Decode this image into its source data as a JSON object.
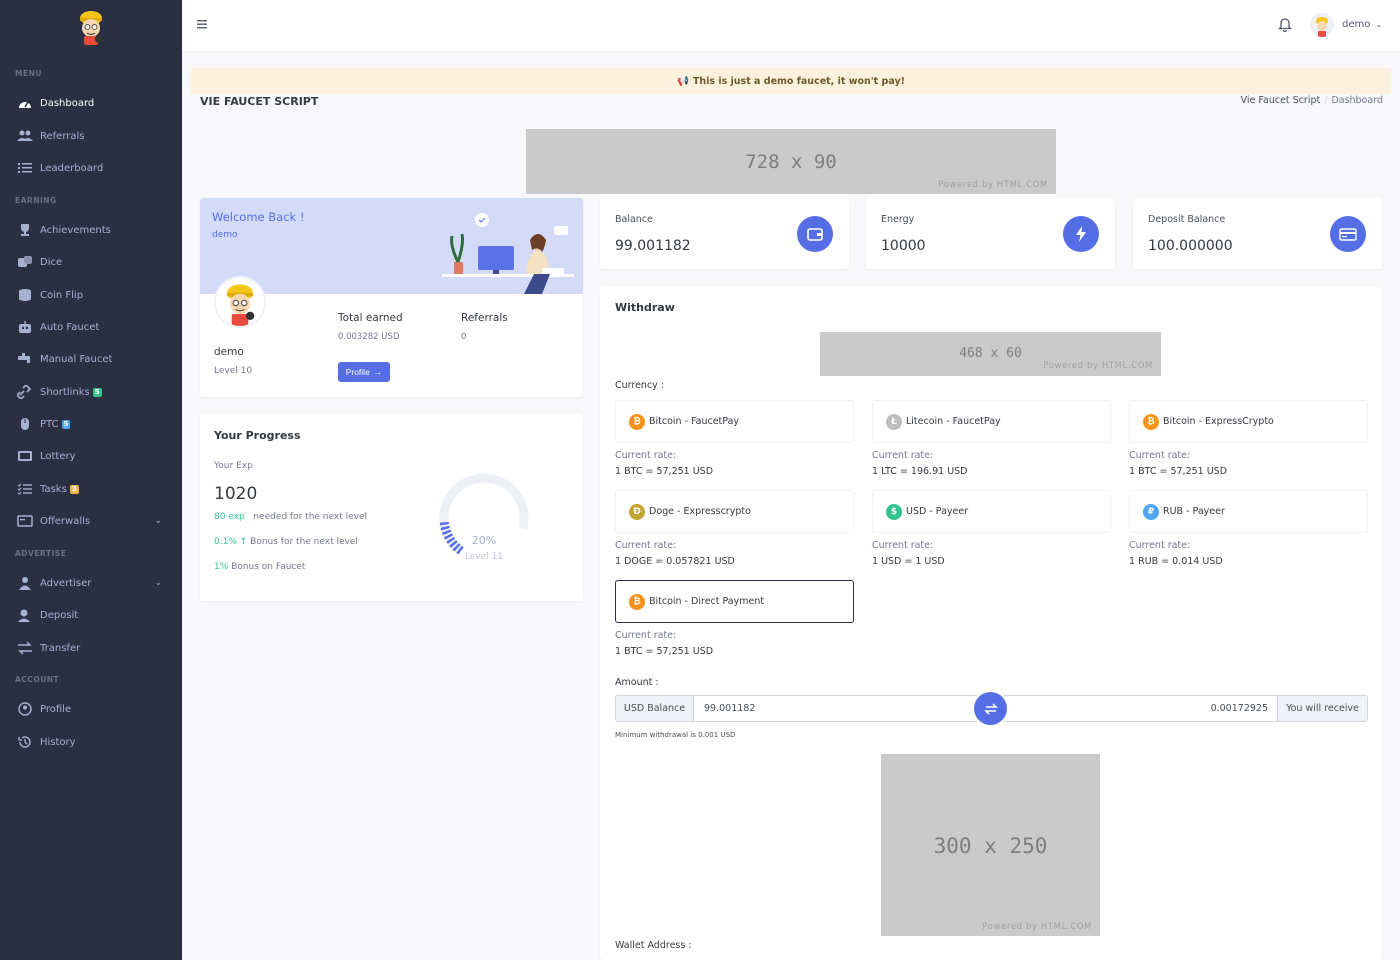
{
  "sidebar": {
    "sections": {
      "menu": "MENU",
      "earning": "EARNING",
      "advertise": "ADVERTISE",
      "account": "ACCOUNT"
    },
    "items": [
      {
        "label": "Dashboard",
        "icon": "dashboard-icon"
      },
      {
        "label": "Referrals",
        "icon": "users-icon"
      },
      {
        "label": "Leaderboard",
        "icon": "list-icon"
      },
      {
        "label": "Achievements",
        "icon": "trophy-icon"
      },
      {
        "label": "Dice",
        "icon": "dice-icon"
      },
      {
        "label": "Coin Flip",
        "icon": "coins-icon"
      },
      {
        "label": "Auto Faucet",
        "icon": "robot-icon"
      },
      {
        "label": "Manual Faucet",
        "icon": "faucet-icon"
      },
      {
        "label": "Shortlinks",
        "icon": "link-icon",
        "badge": "5"
      },
      {
        "label": "PTC",
        "icon": "mouse-icon",
        "badge": "5"
      },
      {
        "label": "Lottery",
        "icon": "ticket-icon"
      },
      {
        "label": "Tasks",
        "icon": "tasks-icon",
        "badge": "3"
      },
      {
        "label": "Offerwalls",
        "icon": "window-icon"
      },
      {
        "label": "Advertiser",
        "icon": "user-tie-icon"
      },
      {
        "label": "Deposit",
        "icon": "deposit-icon"
      },
      {
        "label": "Transfer",
        "icon": "transfer-icon"
      },
      {
        "label": "Profile",
        "icon": "profile-icon"
      },
      {
        "label": "History",
        "icon": "history-icon"
      }
    ]
  },
  "topbar": {
    "user": "demo"
  },
  "alert": "This is just a demo faucet, it won't pay!",
  "page": {
    "title": "VIE FAUCET SCRIPT",
    "breadcrumb": [
      "Vie Faucet Script",
      "Dashboard"
    ]
  },
  "ads": {
    "top": {
      "size": "728 x 90",
      "powered": "Powered by HTML.COM"
    },
    "withdraw": {
      "size": "468 x 60",
      "powered": "Powered by HTML.COM"
    },
    "bottom": {
      "size": "300 x 250",
      "powered": "Powered by HTML.COM"
    }
  },
  "welcome": {
    "title": "Welcome Back !",
    "subtitle": "demo",
    "username": "demo",
    "level": "Level 10",
    "total_earned_label": "Total earned",
    "total_earned": "0.003282 USD",
    "referrals_label": "Referrals",
    "referrals": "0",
    "profile_button": "Profile"
  },
  "progress": {
    "title": "Your Progress",
    "exp_label": "Your Exp",
    "exp": "1020",
    "needed_value": "80 exp",
    "needed_text": "needed for the next level",
    "bonus_next_value": "0.1%",
    "bonus_next_text": "Bonus for the next level",
    "bonus_value": "1%",
    "bonus_text": "Bonus on Faucet",
    "percent": "20%",
    "percent_fraction": 0.2,
    "next_level": "Level 11"
  },
  "stats": [
    {
      "label": "Balance",
      "value": "99.001182",
      "icon": "wallet-icon"
    },
    {
      "label": "Energy",
      "value": "10000",
      "icon": "bolt-icon"
    },
    {
      "label": "Deposit Balance",
      "value": "100.000000",
      "icon": "card-icon"
    }
  ],
  "withdraw": {
    "title": "Withdraw",
    "currency_label": "Currency :",
    "rate_label": "Current rate:",
    "currencies": [
      {
        "name": "Bitcoin - FaucetPay",
        "rate": "1 BTC = 57,251 USD",
        "symbol": "₿",
        "color": "#f7931a"
      },
      {
        "name": "Litecoin - FaucetPay",
        "rate": "1 LTC = 196.91 USD",
        "symbol": "Ł",
        "color": "#bebebe"
      },
      {
        "name": "Bitcoin - ExpressCrypto",
        "rate": "1 BTC = 57,251 USD",
        "symbol": "₿",
        "color": "#f7931a"
      },
      {
        "name": "Doge - Expresscrypto",
        "rate": "1 DOGE = 0.057821 USD",
        "symbol": "Ð",
        "color": "#c2a633"
      },
      {
        "name": "USD - Payeer",
        "rate": "1 USD = 1 USD",
        "symbol": "$",
        "color": "#34c38f"
      },
      {
        "name": "RUB - Payeer",
        "rate": "1 RUB = 0.014 USD",
        "symbol": "₽",
        "color": "#50a5f1"
      },
      {
        "name": "Bitcoin - Direct Payment",
        "rate": "1 BTC = 57,251 USD",
        "symbol": "₿",
        "color": "#f7931a",
        "selected": true
      }
    ],
    "amount_label": "Amount :",
    "balance_addon": "USD Balance",
    "amount_value": "99.001182",
    "receive_value": "0.00172925",
    "receive_addon": "You will receive",
    "min_note": "Minimum withdrawal is 0.001 USD",
    "wallet_label": "Wallet Address :"
  }
}
